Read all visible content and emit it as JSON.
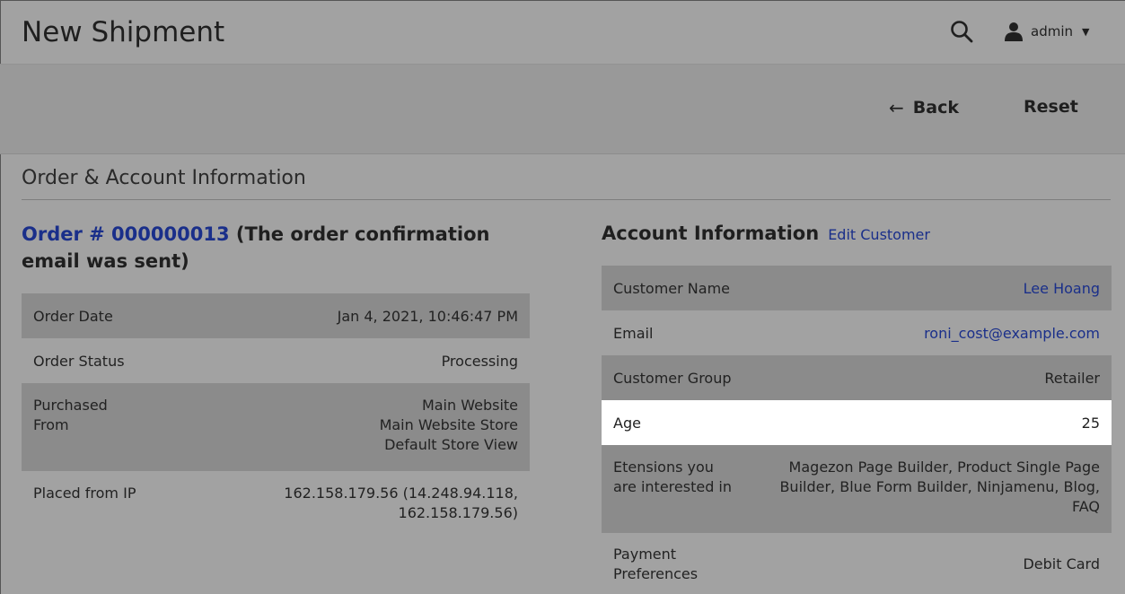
{
  "header": {
    "title": "New Shipment",
    "user_name": "admin"
  },
  "toolbar": {
    "back_label": "Back",
    "back_arrow": "←",
    "reset_label": "Reset"
  },
  "section": {
    "title": "Order & Account Information"
  },
  "order": {
    "link_text": "Order # 000000013",
    "note": "(The order confirmation email was sent)",
    "rows": [
      {
        "label": "Order Date",
        "value": "Jan 4, 2021, 10:46:47 PM"
      },
      {
        "label": "Order Status",
        "value": "Processing"
      },
      {
        "label": "Purchased\nFrom",
        "value": "Main Website\nMain Website Store\nDefault Store View"
      },
      {
        "label": "Placed from IP",
        "value": "162.158.179.56 (14.248.94.118,\n162.158.179.56)"
      }
    ]
  },
  "account": {
    "title": "Account Information",
    "edit_link": "Edit Customer",
    "rows": [
      {
        "label": "Customer Name",
        "value": "Lee Hoang"
      },
      {
        "label": "Email",
        "value": "roni_cost@example.com"
      },
      {
        "label": "Customer Group",
        "value": "Retailer"
      },
      {
        "label": "Age",
        "value": "25"
      },
      {
        "label": "Etensions you\nare interested in",
        "value": "Magezon Page Builder, Product Single Page\nBuilder, Blue Form Builder, Ninjamenu, Blog,\nFAQ"
      },
      {
        "label": "Payment\nPreferences",
        "value": "Debit Card"
      }
    ]
  },
  "colors": {
    "link": "#1a2f8a",
    "background": "#a2a2a2",
    "shaded_row": "#8b8b8b",
    "highlight_row": "#ffffff"
  },
  "icons": {
    "search": "search-icon",
    "user": "user-icon",
    "caret": "chevron-down-icon",
    "back": "arrow-left-icon"
  }
}
